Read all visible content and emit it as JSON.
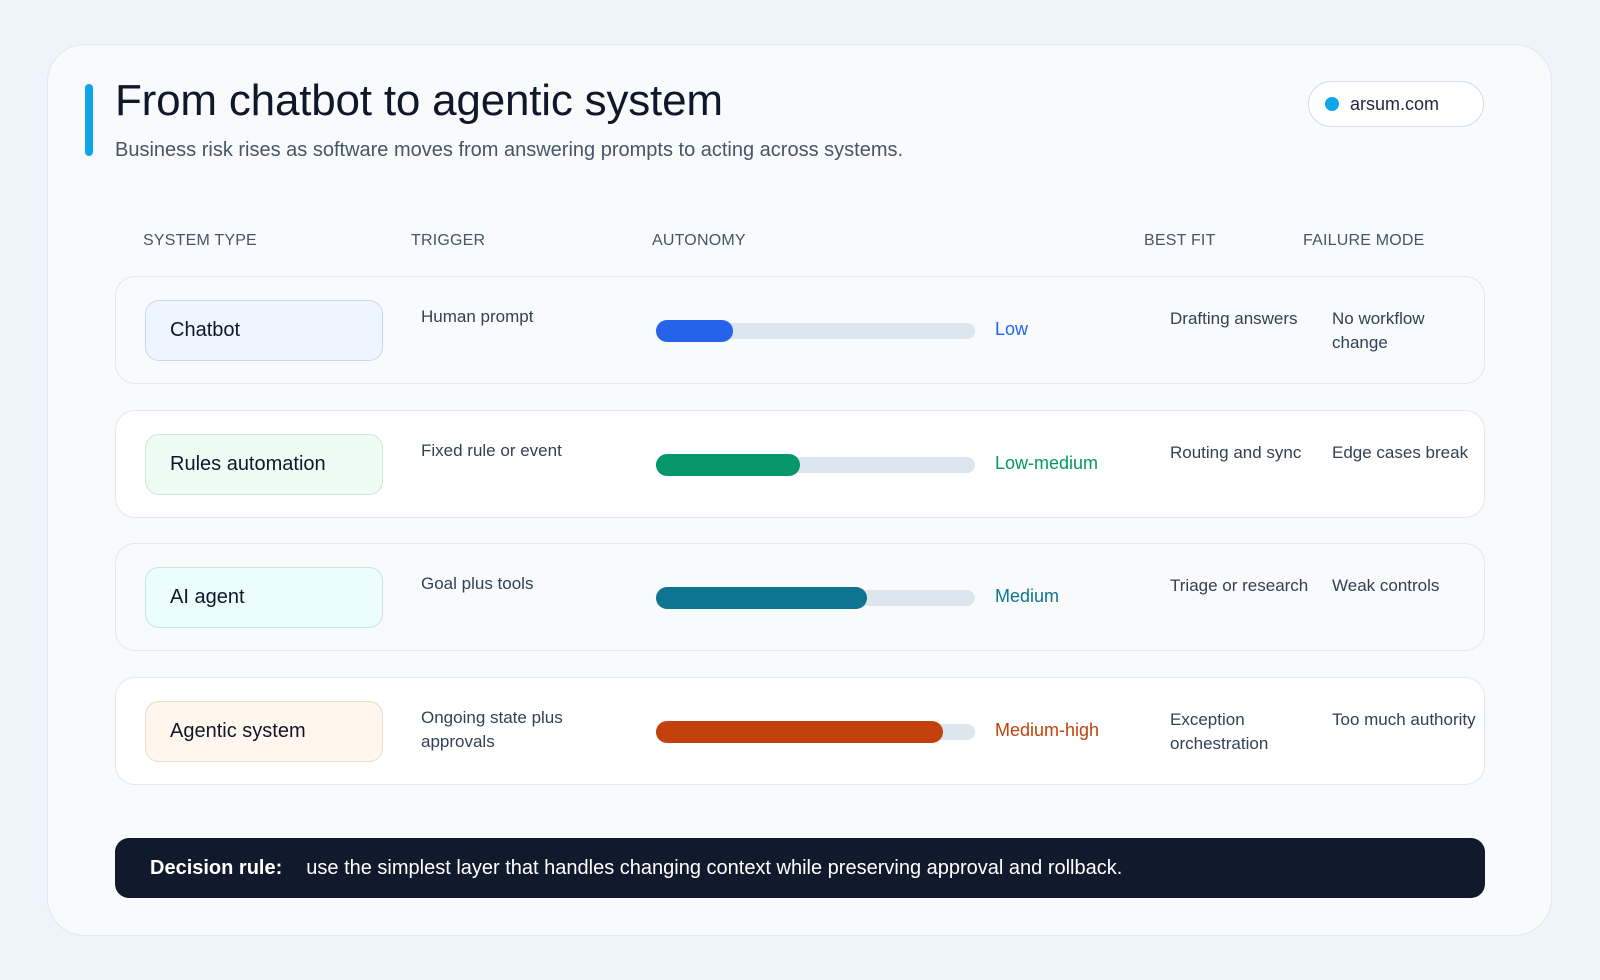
{
  "header": {
    "title": "From chatbot to agentic system",
    "subtitle": "Business risk rises as software moves from answering prompts to acting across systems.",
    "site": "arsum.com",
    "accent_color": "#0ea5e9"
  },
  "columns": {
    "system_type": "SYSTEM TYPE",
    "trigger": "TRIGGER",
    "autonomy": "AUTONOMY",
    "best_fit": "BEST FIT",
    "failure_mode": "FAILURE MODE"
  },
  "rows": [
    {
      "system_type": "Chatbot",
      "trigger": "Human prompt",
      "autonomy_level": "Low",
      "autonomy_fraction": 0.24,
      "best_fit": "Drafting answers",
      "failure_mode": "No workflow change",
      "color": "#2563eb",
      "pill_bg": "#eef5ff",
      "pill_border": "#c7d7ee"
    },
    {
      "system_type": "Rules automation",
      "trigger": "Fixed rule or event",
      "autonomy_level": "Low-medium",
      "autonomy_fraction": 0.45,
      "best_fit": "Routing and sync",
      "failure_mode": "Edge cases break",
      "color": "#059669",
      "pill_bg": "#effcf5",
      "pill_border": "#c9e6d8"
    },
    {
      "system_type": "AI agent",
      "trigger": "Goal plus tools",
      "autonomy_level": "Medium",
      "autonomy_fraction": 0.66,
      "best_fit": "Triage or research",
      "failure_mode": "Weak controls",
      "color": "#0e7490",
      "pill_bg": "#ebfdfd",
      "pill_border": "#c4e3e6"
    },
    {
      "system_type": "Agentic system",
      "trigger": "Ongoing state plus approvals",
      "autonomy_level": "Medium-high",
      "autonomy_fraction": 0.9,
      "best_fit": "Exception orchestration",
      "failure_mode": "Too much authority",
      "color": "#c2410c",
      "pill_bg": "#fff7ed",
      "pill_border": "#e7dccd"
    }
  ],
  "decision": {
    "label": "Decision rule:",
    "text": "use the simplest layer that handles changing context while preserving approval and rollback."
  }
}
